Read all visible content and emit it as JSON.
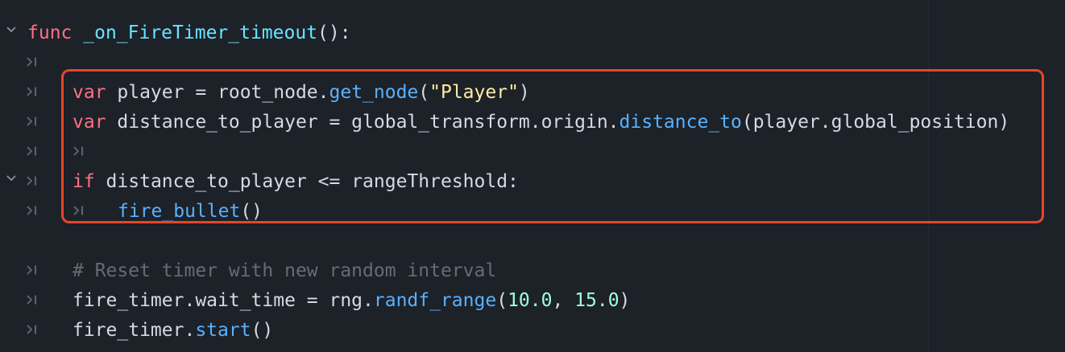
{
  "editor": {
    "language": "GDScript",
    "colors": {
      "background": "#1d2128",
      "keyword": "#ff7085",
      "function_call": "#57b2ff",
      "string": "#ffeda1",
      "number": "#a1ffe0",
      "comment": "#676b73",
      "function_name": "#66e6ff",
      "text": "#d5dae3",
      "highlight_border": "#e5462a"
    },
    "lines": [
      {
        "fold": true,
        "tabs": 0,
        "tokens": [
          {
            "t": "func",
            "c": "kw"
          },
          {
            "t": " ",
            "c": "plain"
          },
          {
            "t": "_on_FireTimer_timeout",
            "c": "decl"
          },
          {
            "t": "():",
            "c": "plain"
          }
        ]
      },
      {
        "fold": false,
        "tabs": 1,
        "tokens": []
      },
      {
        "fold": false,
        "tabs": 1,
        "tokens": [
          {
            "t": "var",
            "c": "kw"
          },
          {
            "t": " player = root_node.",
            "c": "plain"
          },
          {
            "t": "get_node",
            "c": "fn"
          },
          {
            "t": "(",
            "c": "plain"
          },
          {
            "t": "\"Player\"",
            "c": "str"
          },
          {
            "t": ")",
            "c": "plain"
          }
        ]
      },
      {
        "fold": false,
        "tabs": 1,
        "tokens": [
          {
            "t": "var",
            "c": "kw"
          },
          {
            "t": " distance_to_player = global_transform.origin.",
            "c": "plain"
          },
          {
            "t": "distance_to",
            "c": "fn"
          },
          {
            "t": "(player.global_position)",
            "c": "plain"
          }
        ]
      },
      {
        "fold": false,
        "tabs": 2,
        "tokens": []
      },
      {
        "fold": true,
        "tabs": 1,
        "tokens": [
          {
            "t": "if",
            "c": "kw"
          },
          {
            "t": " distance_to_player <= rangeThreshold:",
            "c": "plain"
          }
        ]
      },
      {
        "fold": false,
        "tabs": 2,
        "tokens": [
          {
            "t": "fire_bullet",
            "c": "fn"
          },
          {
            "t": "()",
            "c": "plain"
          }
        ]
      },
      {
        "fold": false,
        "tabs": 0,
        "tokens": []
      },
      {
        "fold": false,
        "tabs": 1,
        "tokens": [
          {
            "t": "# Reset timer with new random interval",
            "c": "cmt"
          }
        ]
      },
      {
        "fold": false,
        "tabs": 1,
        "tokens": [
          {
            "t": "fire_timer.wait_time = rng.",
            "c": "plain"
          },
          {
            "t": "randf_range",
            "c": "fn"
          },
          {
            "t": "(",
            "c": "plain"
          },
          {
            "t": "10.0",
            "c": "num"
          },
          {
            "t": ", ",
            "c": "plain"
          },
          {
            "t": "15.0",
            "c": "num"
          },
          {
            "t": ")",
            "c": "plain"
          }
        ]
      },
      {
        "fold": false,
        "tabs": 1,
        "tokens": [
          {
            "t": "fire_timer.",
            "c": "plain"
          },
          {
            "t": "start",
            "c": "fn"
          },
          {
            "t": "()",
            "c": "plain"
          }
        ]
      }
    ]
  }
}
